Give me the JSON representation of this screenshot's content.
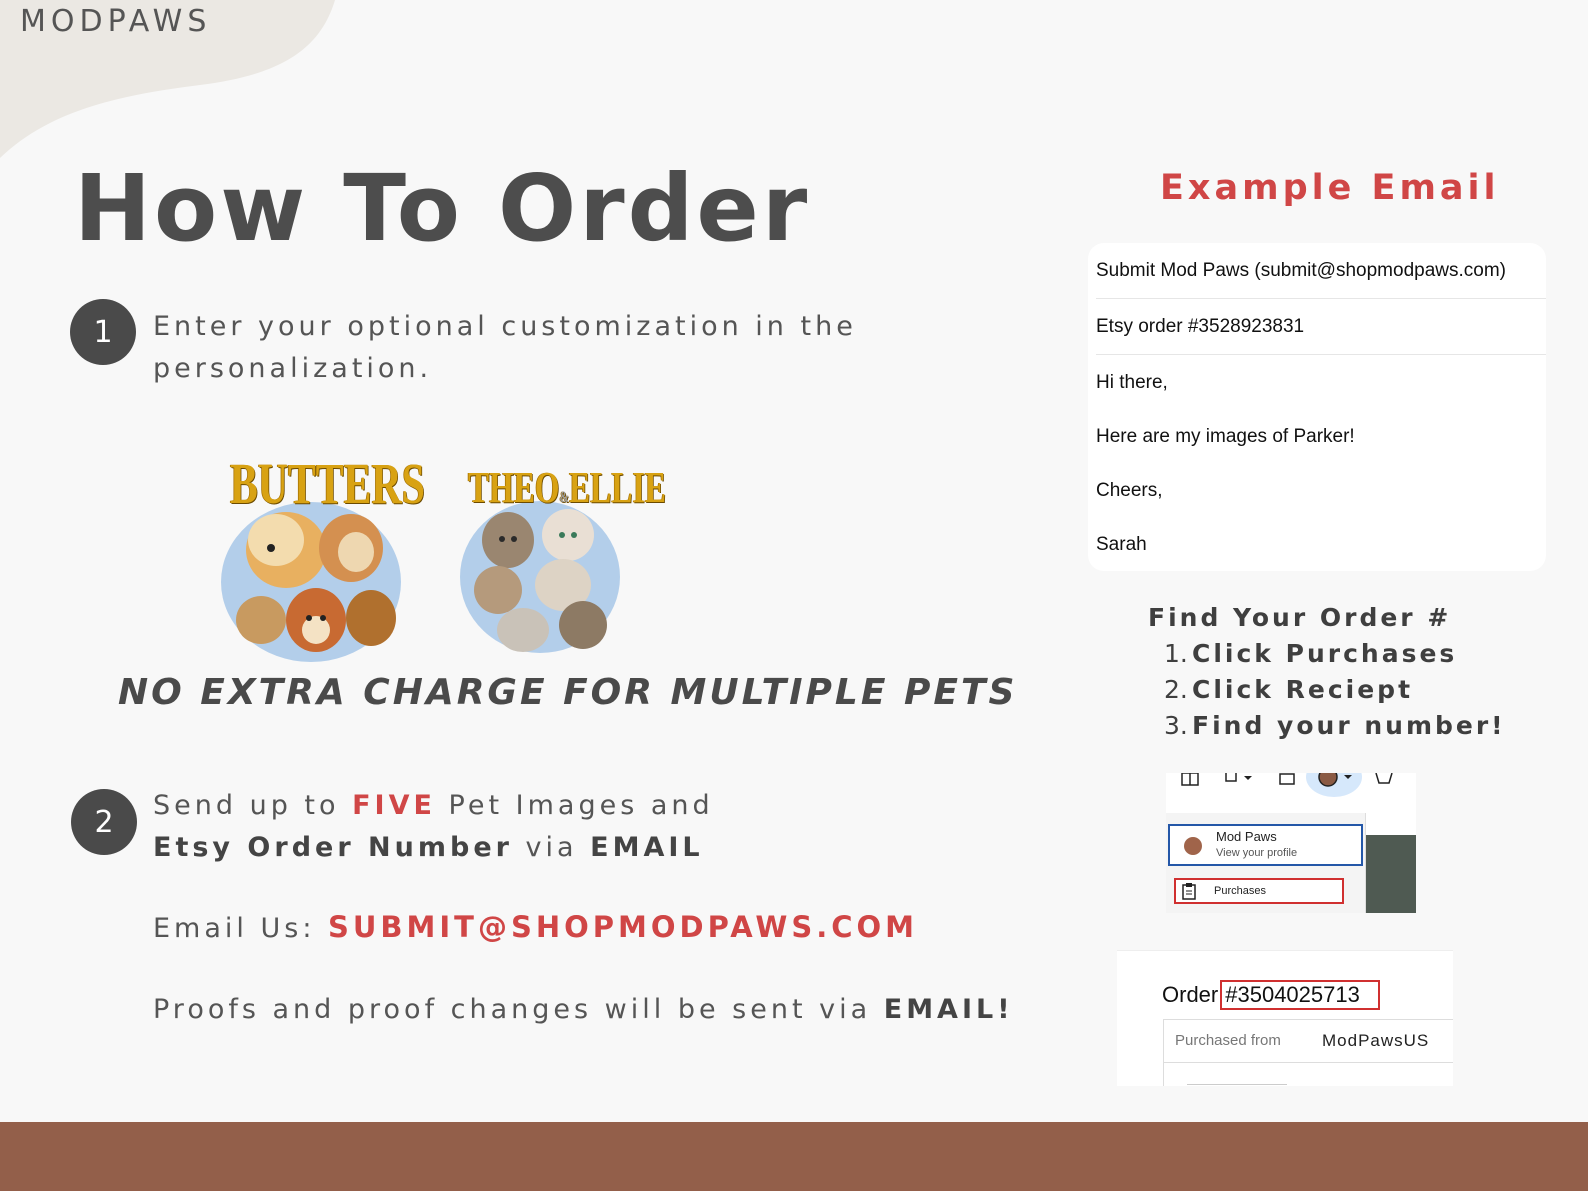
{
  "brand": "MODPAWS",
  "title": "How To Order",
  "step1": {
    "number": "1",
    "text_line1": "Enter your optional customization in the",
    "text_line2": "personalization."
  },
  "pets": {
    "card1_name": "BUTTERS",
    "card2_name": "THEO ELLIE",
    "card2_name_left": "THEO",
    "card2_name_right": "ELLIE"
  },
  "no_extra_charge": "NO EXTRA CHARGE FOR MULTIPLE PETS",
  "step2": {
    "number": "2",
    "line1_prefix": "Send up to ",
    "line1_highlight": "FIVE",
    "line1_suffix": " Pet Images and",
    "line2_bold": "Etsy Order Number",
    "line2_mid": " via ",
    "line2_end": "EMAIL"
  },
  "email_us": {
    "label": "Email Us: ",
    "address": "SUBMIT@SHOPMODPAWS.COM"
  },
  "proofs": {
    "text": "Proofs and proof changes will be sent via ",
    "bold": "EMAIL!"
  },
  "example_email": {
    "title": "Example Email",
    "to": "Submit Mod Paws (submit@shopmodpaws.com)",
    "subject": "Etsy order #3528923831",
    "greeting": "Hi there,",
    "body": "Here are my images of Parker!",
    "signoff": "Cheers,",
    "name": "Sarah"
  },
  "find_order": {
    "heading": "Find Your Order #",
    "steps": [
      {
        "num": "1.",
        "text": "Click Purchases"
      },
      {
        "num": "2.",
        "text": "Click Reciept"
      },
      {
        "num": "3.",
        "text": "Find your number!"
      }
    ]
  },
  "etsy_menu": {
    "profile_name": "Mod Paws",
    "profile_sub": "View your profile",
    "purchases": "Purchases"
  },
  "etsy_order": {
    "label": "Order",
    "number": "#3504025713",
    "purchased_from_label": "Purchased from",
    "shop": "ModPawsUS"
  },
  "colors": {
    "accent_red": "#d04646",
    "text_dark": "#4a4a4a",
    "footer_brown": "#935f4a",
    "blob_beige": "#ebe8e3"
  }
}
